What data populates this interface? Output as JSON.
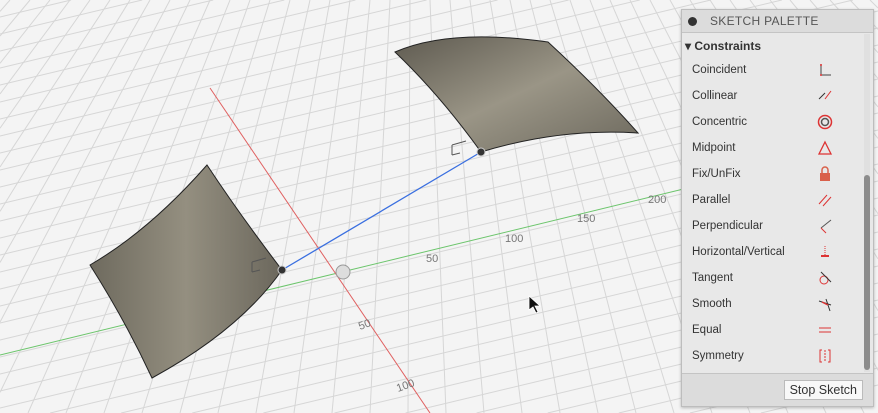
{
  "palette": {
    "title": "SKETCH PALETTE",
    "section": "Constraints",
    "stop_label": "Stop Sketch",
    "items": [
      {
        "label": "Coincident",
        "icon": "coincident-icon"
      },
      {
        "label": "Collinear",
        "icon": "collinear-icon"
      },
      {
        "label": "Concentric",
        "icon": "concentric-icon"
      },
      {
        "label": "Midpoint",
        "icon": "midpoint-icon"
      },
      {
        "label": "Fix/UnFix",
        "icon": "lock-icon"
      },
      {
        "label": "Parallel",
        "icon": "parallel-icon"
      },
      {
        "label": "Perpendicular",
        "icon": "perpendicular-icon"
      },
      {
        "label": "Horizontal/Vertical",
        "icon": "horizontal-vertical-icon"
      },
      {
        "label": "Tangent",
        "icon": "tangent-icon"
      },
      {
        "label": "Smooth",
        "icon": "smooth-icon"
      },
      {
        "label": "Equal",
        "icon": "equal-icon"
      },
      {
        "label": "Symmetry",
        "icon": "symmetry-icon"
      }
    ]
  },
  "viewport": {
    "green_axis_labels": [
      "50",
      "100",
      "150",
      "200"
    ],
    "red_axis_labels": [
      "50",
      "100"
    ],
    "accent": "#d9302c",
    "line_color": "#3a6fe0"
  }
}
